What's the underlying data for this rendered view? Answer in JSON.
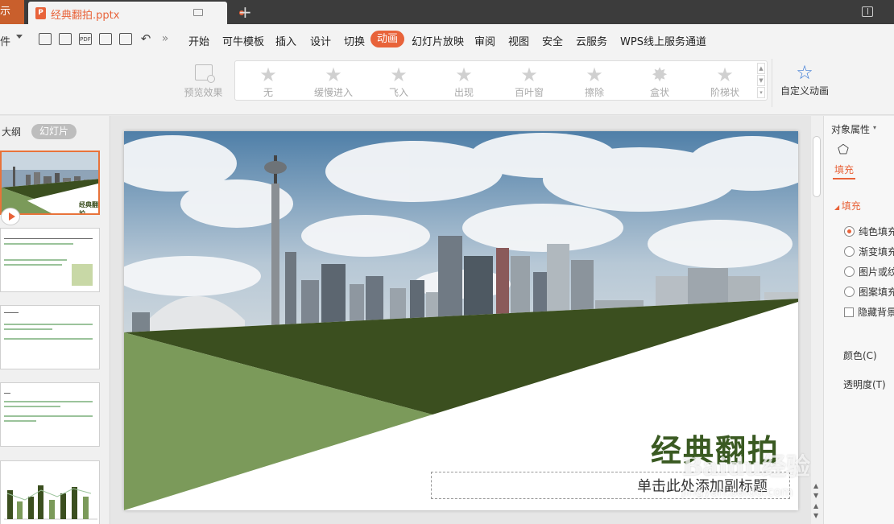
{
  "tabs": {
    "prev_label": "示",
    "doc_name": "经典翻拍.pptx",
    "doc_icon": "P",
    "add_label": "+"
  },
  "menu": {
    "file_label": "件",
    "more_label": "»",
    "items": [
      "开始",
      "可牛模板",
      "插入",
      "设计",
      "切换",
      "动画",
      "幻灯片放映",
      "审阅",
      "视图",
      "安全",
      "云服务",
      "WPS线上服务通道"
    ],
    "active": "动画"
  },
  "ribbon": {
    "preview_label": "预览效果",
    "animations": [
      "无",
      "缓慢进入",
      "飞入",
      "出现",
      "百叶窗",
      "擦除",
      "盒状",
      "阶梯状"
    ],
    "custom_label": "自定义动画"
  },
  "left_panel": {
    "outline_tab": "大纲",
    "slides_tab": "幻灯片",
    "thumb1_title": "经典翻拍"
  },
  "slide": {
    "title": "经典翻拍",
    "subtitle": "单击此处添加副标题"
  },
  "right_panel": {
    "title": "对象属性",
    "fill_tab": "填充",
    "section": "填充",
    "options": [
      "纯色填充",
      "渐变填充",
      "图片或纹理填充",
      "图案填充"
    ],
    "hide_bg": "隐藏背景图形",
    "color_label": "颜色(C)",
    "transparency_label": "透明度(T)"
  },
  "watermark": {
    "brand": "Baidu经验",
    "url": "jingyan.baidu.com"
  },
  "colors": {
    "accent": "#e8633a",
    "slide_dark_green": "#3b4f1f",
    "slide_light_green": "#7b9a5a"
  }
}
